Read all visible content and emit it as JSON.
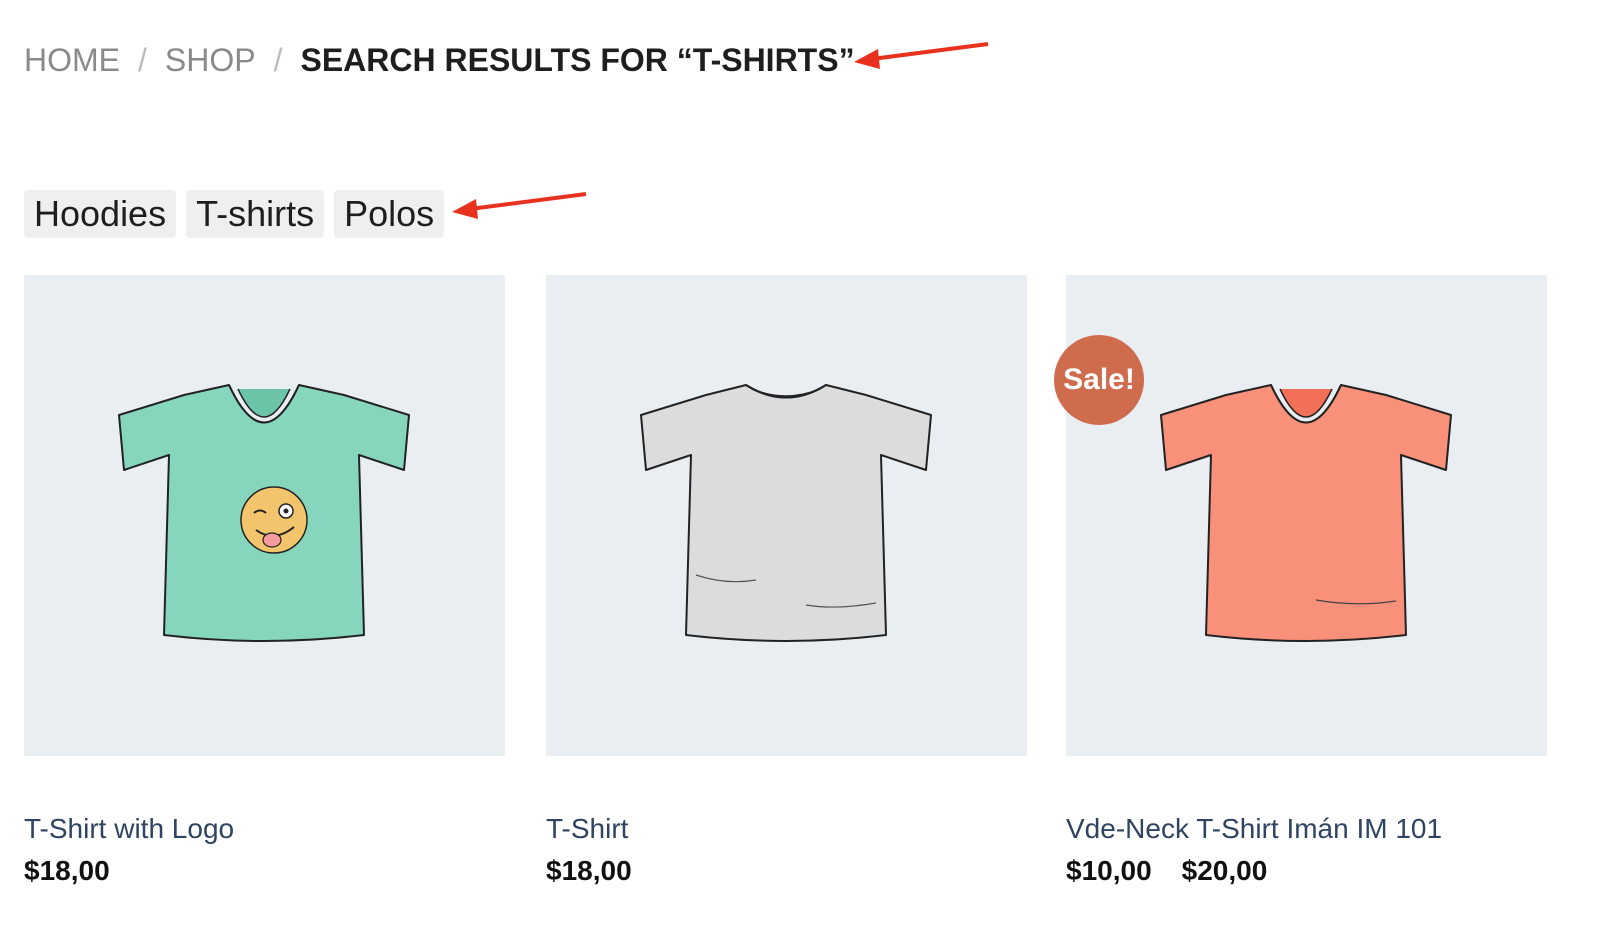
{
  "breadcrumb": {
    "home": "HOME",
    "shop": "SHOP",
    "separator": "/",
    "current": "SEARCH RESULTS FOR “T-SHIRTS”"
  },
  "tags": [
    "Hoodies",
    "T-shirts",
    "Polos"
  ],
  "products": [
    {
      "title": "T-Shirt with Logo",
      "price": "$18,00",
      "shirt_color": "#86d6bd",
      "image": "teal-vneck-tshirt-with-emoji"
    },
    {
      "title": "T-Shirt",
      "price": "$18,00",
      "shirt_color": "#dcdcdc",
      "image": "grey-crewneck-tshirt"
    },
    {
      "title": "Vde-Neck T-Shirt Imán IM 101",
      "price": "$10,00",
      "price_2": "$20,00",
      "badge": "Sale!",
      "shirt_color": "#f9907a",
      "image": "coral-vneck-tshirt"
    }
  ],
  "colors": {
    "accent_arrow": "#e8321f",
    "sale_badge": "#d06c4e",
    "image_bg": "#e9eef2",
    "link_text": "#2f4460"
  }
}
